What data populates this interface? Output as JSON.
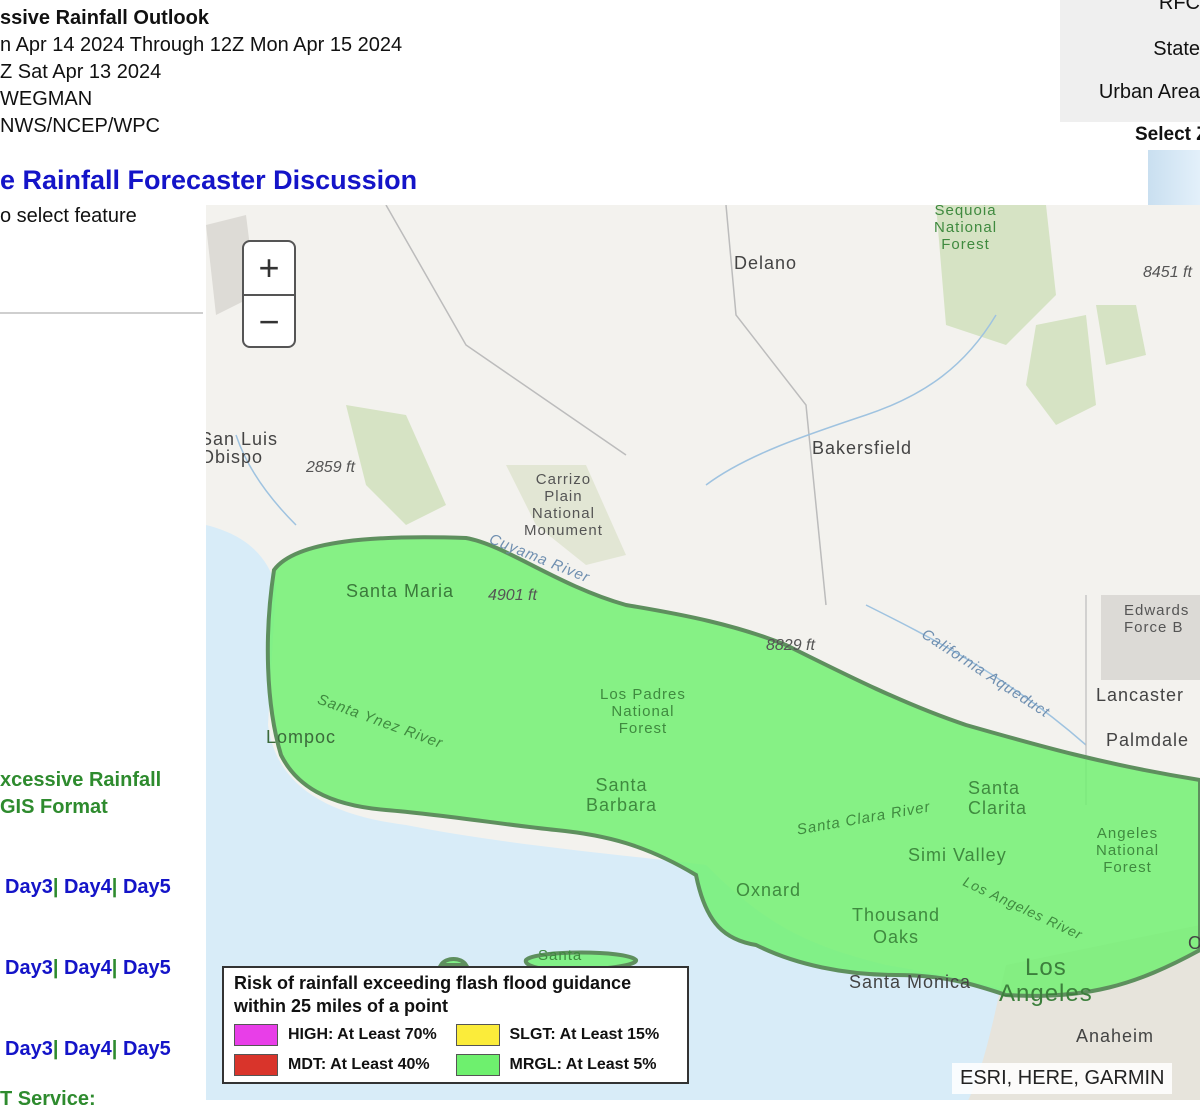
{
  "header": {
    "title": "ssive Rainfall Outlook",
    "valid": "n Apr 14 2024 Through 12Z Mon Apr 15 2024",
    "issued": "Z Sat Apr 13 2024",
    "forecaster": "WEGMAN",
    "office": "NWS/NCEP/WPC"
  },
  "discussion_link": "e Rainfall Forecaster Discussion",
  "select_hint": "o select feature",
  "gis": {
    "title_line1": "xcessive Rainfall",
    "title_line2": " GIS Format",
    "rows": [
      {
        "links": [
          "Day3",
          "Day4",
          "Day5"
        ]
      },
      {
        "links": [
          "Day3",
          "Day4",
          "Day5"
        ]
      },
      {
        "links": [
          "Day3",
          "Day4",
          "Day5"
        ]
      }
    ],
    "separator": "|"
  },
  "service_label": "T Service:",
  "layers_panel": {
    "options": [
      "RFC",
      "State",
      "Urban Area"
    ],
    "select_label": "Select Z"
  },
  "map": {
    "zoom_in": "+",
    "zoom_out": "−",
    "labels": {
      "delano": "Delano",
      "sequoia": "Sequoia\nNational\nForest",
      "elev_8451": "8451 ft",
      "san_luis": "San Luis\nObispo",
      "elev_2859": "2859 ft",
      "carrizo": "Carrizo\nPlain\nNational\nMonument",
      "bakersfield": "Bakersfield",
      "cuyama": "Cuyama River",
      "santa_maria": "Santa Maria",
      "elev_4901": "4901 ft",
      "elev_8829": "8829 ft",
      "ca_aqueduct": "California Aqueduct",
      "edwards": "Edwards\nForce B",
      "lancaster": "Lancaster",
      "palmdale": "Palmdale",
      "los_padres": "Los Padres\nNational\nForest",
      "santa_ynez": "Santa Ynez River",
      "lompoc": "Lompoc",
      "santa_barbara": "Santa\nBarbara",
      "santa_clara": "Santa Clara River",
      "santa_clarita": "Santa\nClarita",
      "angeles": "Angeles\nNational\nForest",
      "simi": "Simi Valley",
      "oxnard": "Oxnard",
      "thousand_oaks": "Thousand\nOaks",
      "la_river": "Los Angeles River",
      "santa_monica": "Santa Monica",
      "los_angeles": "Los\nAngeles",
      "anaheim": "Anaheim",
      "santa_island": "Santa",
      "on": "On"
    },
    "attribution": "ESRI, HERE, GARMIN"
  },
  "legend": {
    "title": "Risk of rainfall exceeding flash flood guidance within 25 miles of a point",
    "items": [
      {
        "label": "HIGH: At Least 70%",
        "color": "#e83ee8"
      },
      {
        "label": "SLGT: At Least 15%",
        "color": "#fbec3a"
      },
      {
        "label": "MDT: At Least 40%",
        "color": "#d9342b"
      },
      {
        "label": "MRGL: At Least 5%",
        "color": "#6ef06e"
      }
    ]
  },
  "colors": {
    "link_blue": "#1414c8",
    "gis_green": "#2e8b2e",
    "mrgl_fill": "#6ef06e",
    "mrgl_outline": "#5e8f5e",
    "ocean": "#d8ecf8"
  }
}
